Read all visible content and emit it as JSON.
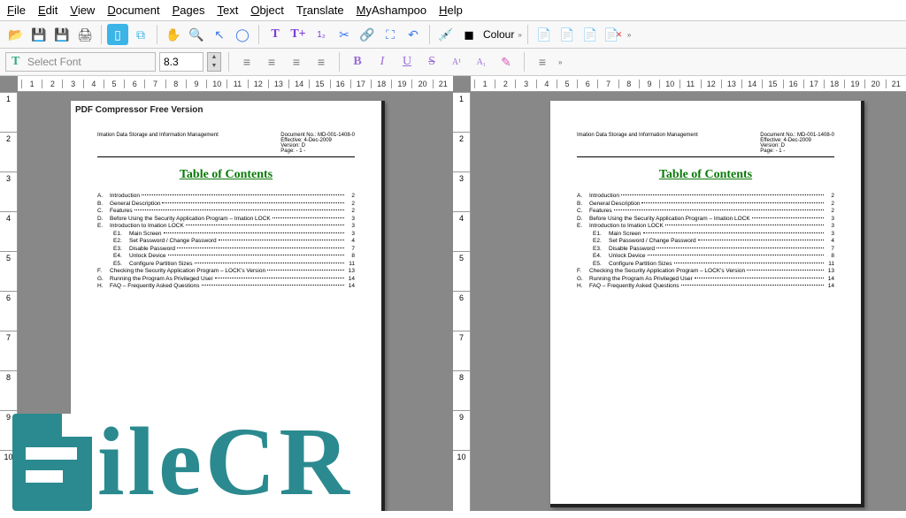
{
  "menu": [
    "File",
    "Edit",
    "View",
    "Document",
    "Pages",
    "Text",
    "Object",
    "Translate",
    "MyAshampoo",
    "Help"
  ],
  "font": {
    "placeholder": "Select Font",
    "size": "8.3"
  },
  "colour_label": "Colour",
  "ruler_h": [
    1,
    2,
    3,
    4,
    5,
    6,
    7,
    8,
    9,
    10,
    11,
    12,
    13,
    14,
    15,
    16,
    17,
    18,
    19,
    20,
    21
  ],
  "ruler_v": [
    1,
    2,
    3,
    4,
    5,
    6,
    7,
    8,
    9,
    10
  ],
  "doc": {
    "watermark": "PDF Compressor Free Version",
    "header_left": "Imation Data Storage and Information Management",
    "header_right": [
      "Document No.:  MD-001-1408-0",
      "Effective:          4-Dec-2009",
      "Version:            D",
      "Page:                - 1 -"
    ],
    "toc_title": "Table of Contents",
    "toc": [
      {
        "i": "A.",
        "t": "Introduction",
        "p": "2"
      },
      {
        "i": "B.",
        "t": "General Description",
        "p": "2"
      },
      {
        "i": "C.",
        "t": "Features",
        "p": "2"
      },
      {
        "i": "D.",
        "t": "Before Using the Security Application Program – Imation LOCK",
        "p": "3"
      },
      {
        "i": "E.",
        "t": "Introduction to Imation LOCK",
        "p": "3"
      }
    ],
    "toc_sub": [
      {
        "i": "E1.",
        "t": "Main Screen",
        "p": "3"
      },
      {
        "i": "E2.",
        "t": "Set Password / Change Password",
        "p": "4"
      },
      {
        "i": "E3.",
        "t": "Disable Password",
        "p": "7"
      },
      {
        "i": "E4.",
        "t": "Unlock Device",
        "p": "8"
      },
      {
        "i": "E5.",
        "t": "Configure Partition Sizes",
        "p": "11"
      }
    ],
    "toc2": [
      {
        "i": "F.",
        "t": "Checking the Security Application Program – LOCK's Version",
        "p": "13"
      },
      {
        "i": "G.",
        "t": "Running the Program As Privileged User",
        "p": "14"
      },
      {
        "i": "H.",
        "t": "FAQ – Frequently Asked Questions",
        "p": "14"
      }
    ]
  },
  "logo_text": "ileCR"
}
